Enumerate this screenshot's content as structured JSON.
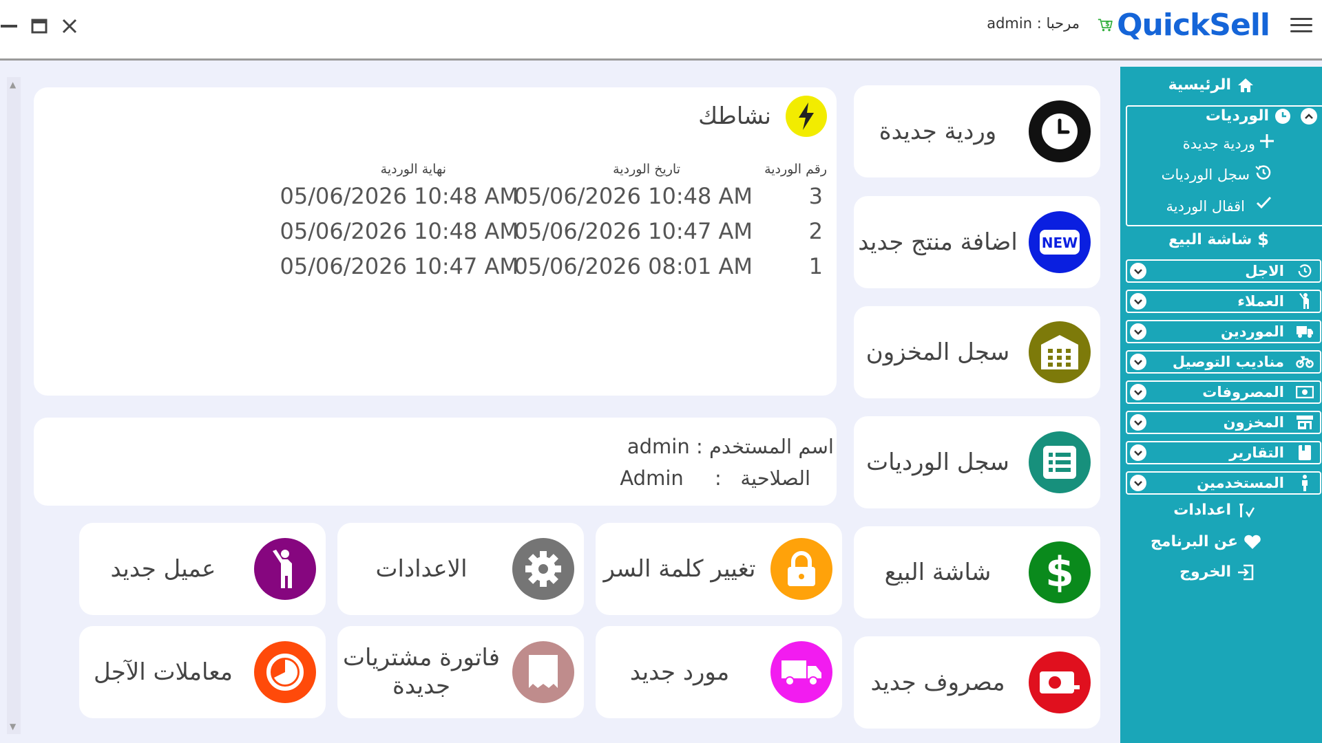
{
  "app": {
    "greeting": "مرحبا : admin",
    "logo_text": "QuickSell",
    "accent": "#1aa6b8"
  },
  "activity": {
    "title": "نشاطك",
    "columns": [
      "رقم الوردية",
      "تاريخ الوردية",
      "نهاية الوردية"
    ],
    "rows": [
      {
        "num": "3",
        "start": "05/06/2026 10:48 AM",
        "end": "05/06/2026 10:48 AM"
      },
      {
        "num": "2",
        "start": "05/06/2026 10:47 AM",
        "end": "05/06/2026 10:48 AM"
      },
      {
        "num": "1",
        "start": "05/06/2026 08:01 AM",
        "end": "05/06/2026 10:47 AM"
      }
    ]
  },
  "user_info": {
    "username_label": "اسم المستخدم :",
    "username": "admin",
    "role_label": "الصلاحية   :",
    "role": "Admin"
  },
  "tiles": {
    "new_shift": "وردية جديدة",
    "add_product": "اضافة منتج جديد",
    "inventory_log": "سجل المخزون",
    "shifts_log": "سجل الورديات",
    "sales_screen": "شاشة البيع",
    "new_expense": "مصروف جديد",
    "change_password": "تغيير كلمة السر",
    "new_supplier": "مورد جديد",
    "settings": "الاعدادات",
    "new_purchase_invoice": "فاتورة مشتريات جديدة",
    "new_customer": "عميل جديد",
    "credit_transactions": "معاملات الآجل",
    "new_badge": "NEW"
  },
  "sidebar": {
    "home": "الرئيسية",
    "shifts": "الورديات",
    "shifts_sub": [
      "وردية جديدة",
      "سجل الورديات",
      "اقفال الوردية"
    ],
    "sales_screen": "شاشة البيع",
    "groups": [
      "الاجل",
      "العملاء",
      "الموردين",
      "مناديب التوصيل",
      "المصروفات",
      "المخزون",
      "التقارير",
      "المستخدمين"
    ],
    "settings": "اعدادات",
    "about": "عن البرنامج",
    "logout": "الخروج"
  }
}
